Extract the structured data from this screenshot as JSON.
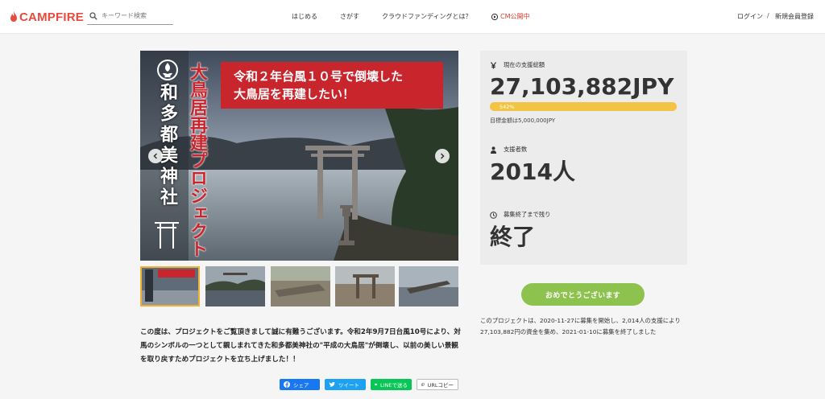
{
  "header": {
    "logo": "CAMPFIRE",
    "search_placeholder": "キーワード検索",
    "nav": [
      "はじめる",
      "さがす",
      "クラウドファンディングとは？",
      "CM公開中"
    ],
    "login": "ログイン",
    "separator": "/",
    "register": "新規会員登録"
  },
  "hero": {
    "banner_line1": "令和２年台風１０号で倒壊した",
    "banner_line2": "大鳥居を再建したい！",
    "vertical_red": "大鳥居再建プロジェクト",
    "vertical_white": "和多都美神社"
  },
  "intro_text": "この度は、プロジェクトをご覧頂きまして誠に有難うございます。令和2年9月7日台風10号により、対馬のシンボルの一つとして親しまれてきた和多都美神社の\"平成の大鳥居\"が倒壊し、以前の美しい景観を取り戻すためプロジェクトを立ち上げました！！",
  "share": {
    "facebook": "シェア",
    "twitter": "ツイート",
    "line": "LINEで送る",
    "copy": "URLコピー"
  },
  "stats": {
    "total_label": "現在の支援総額",
    "total_value": "27,103,882JPY",
    "progress_percent": 542,
    "progress_text": "542%",
    "goal_text": "目標金額は5,000,000JPY",
    "backers_label": "支援者数",
    "backers_value": "2014人",
    "remaining_label": "募集終了まで残り",
    "remaining_value": "終了"
  },
  "congrats_button": "おめでとうございます",
  "summary": "このプロジェクトは、2020-11-27に募集を開始し、2,014人の支援により27,103,882円の資金を集め、2021-01-10に募集を終了しました",
  "colors": {
    "brand": "#e84a3b",
    "progress": "#f3c344",
    "congrats": "#8dc24e",
    "banner": "#c8252d"
  }
}
